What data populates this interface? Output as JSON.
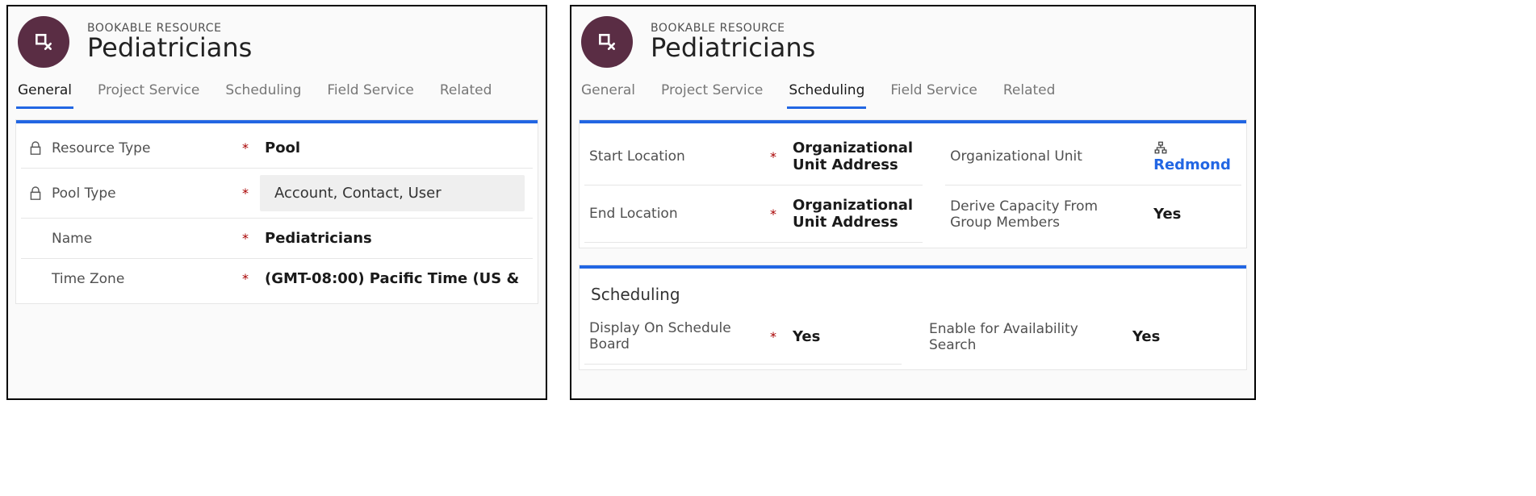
{
  "left": {
    "eyebrow": "BOOKABLE RESOURCE",
    "title": "Pediatricians",
    "tabs": [
      "General",
      "Project Service",
      "Scheduling",
      "Field Service",
      "Related"
    ],
    "activeTab": 0,
    "fields": {
      "resource_type": {
        "label": "Resource Type",
        "value": "Pool",
        "locked": true,
        "required": true
      },
      "pool_type": {
        "label": "Pool Type",
        "value": "Account, Contact, User",
        "locked": true,
        "required": true,
        "boxed": true
      },
      "name": {
        "label": "Name",
        "value": "Pediatricians",
        "required": true
      },
      "time_zone": {
        "label": "Time Zone",
        "value": "(GMT-08:00) Pacific Time (US &",
        "required": true
      }
    }
  },
  "right": {
    "eyebrow": "BOOKABLE RESOURCE",
    "title": "Pediatricians",
    "tabs": [
      "General",
      "Project Service",
      "Scheduling",
      "Field Service",
      "Related"
    ],
    "activeTab": 2,
    "top": {
      "start_location": {
        "label": "Start Location",
        "value": "Organizational Unit Address",
        "required": true
      },
      "org_unit": {
        "label": "Organizational Unit",
        "value": "Redmond"
      },
      "end_location": {
        "label": "End Location",
        "value": "Organizational Unit Address",
        "required": true
      },
      "derive_cap": {
        "label": "Derive Capacity From Group Members",
        "value": "Yes"
      }
    },
    "scheduling": {
      "section": "Scheduling",
      "display_board": {
        "label": "Display On Schedule Board",
        "value": "Yes",
        "required": true
      },
      "avail_search": {
        "label": "Enable for Availability Search",
        "value": "Yes"
      }
    }
  }
}
